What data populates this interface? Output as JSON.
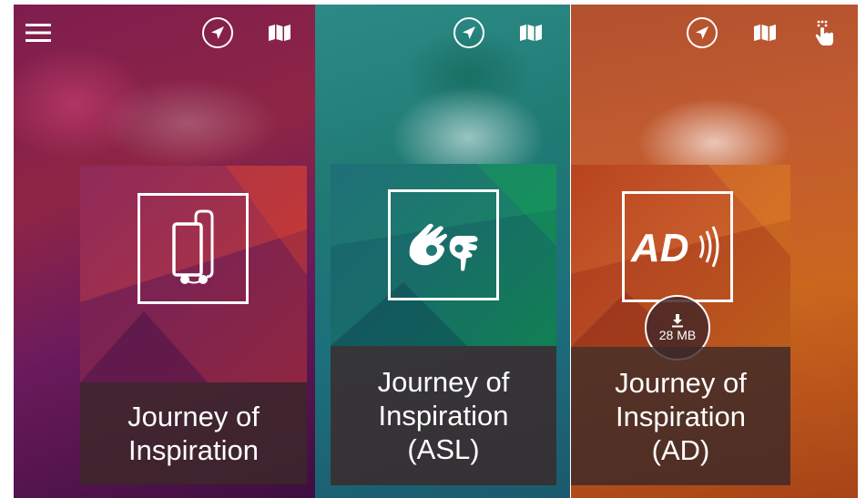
{
  "screens": [
    {
      "id": "standard",
      "card_title_lines": [
        "Journey of",
        "Inspiration"
      ],
      "card_icon": "phone-earbuds-icon",
      "top_icons": [
        "menu-icon",
        "navigation-arrow-icon",
        "map-icon"
      ]
    },
    {
      "id": "asl",
      "card_title_lines": [
        "Journey of",
        "Inspiration",
        "(ASL)"
      ],
      "card_icon": "sign-language-icon",
      "top_icons": [
        "navigation-arrow-icon",
        "map-icon"
      ]
    },
    {
      "id": "ad",
      "card_title_lines": [
        "Journey of",
        "Inspiration",
        "(AD)"
      ],
      "card_icon": "audio-description-icon",
      "top_icons": [
        "navigation-arrow-icon",
        "map-icon",
        "tap-gesture-icon"
      ],
      "download": {
        "size": "28 MB",
        "icon": "download-icon"
      },
      "ad_logo_text": "AD"
    }
  ],
  "colors": {
    "screen1_accent": "#8e2545",
    "screen2_accent": "#1f7a73",
    "screen3_accent": "#c25c30",
    "card_caption_bg": "#3c2828",
    "foreground": "#ffffff"
  }
}
